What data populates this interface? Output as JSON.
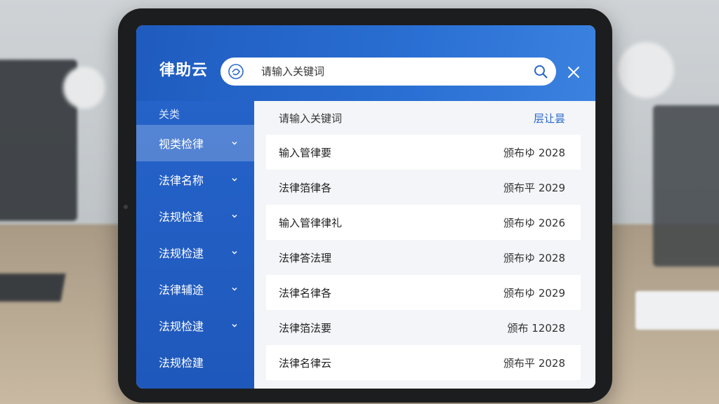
{
  "app": {
    "brand": "律助云"
  },
  "search": {
    "placeholder": "请输入关键词"
  },
  "sidebar": {
    "header": "关类",
    "items": [
      {
        "label": "视类检律",
        "active": true
      },
      {
        "label": "法律名称",
        "active": false
      },
      {
        "label": "法规检逢",
        "active": false
      },
      {
        "label": "法规检逮",
        "active": false
      },
      {
        "label": "法律辅途",
        "active": false
      },
      {
        "label": "法规检逮",
        "active": false
      },
      {
        "label": "法规检建",
        "active": false
      }
    ]
  },
  "panel": {
    "title": "请输入关键词",
    "action": "层让昙",
    "rows": [
      {
        "name": "输入管律要",
        "date": "颁布ゆ 2028"
      },
      {
        "name": "法律箔律各",
        "date": "颁布平 2029"
      },
      {
        "name": "输入管律律礼",
        "date": "颁布ゆ 2026"
      },
      {
        "name": "法律答法理",
        "date": "颁布ゆ 2028"
      },
      {
        "name": "法律名律各",
        "date": "颁布ゆ 2029"
      },
      {
        "name": "法律箔法要",
        "date": "颁布 12028"
      },
      {
        "name": "法律名律云",
        "date": "颁布平 2028"
      }
    ]
  },
  "colors": {
    "header_blue": "#2a6fd3",
    "sidebar_blue": "#2563c9",
    "accent_blue": "#2a67cc"
  },
  "icons": {
    "search": "search-icon",
    "close": "close-icon",
    "chevron": "chevron-down-icon",
    "logo": "brand-logo-icon"
  }
}
